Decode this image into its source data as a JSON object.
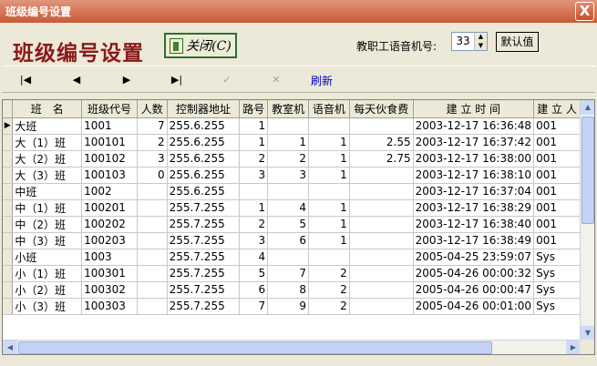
{
  "window": {
    "title": "班级编号设置",
    "close_glyph": "X"
  },
  "header": {
    "heading": "班级编号设置",
    "close_button_label": "关闭(C)"
  },
  "toolbar": {
    "first_icon": "first-record-icon",
    "first_glyph": "|◀",
    "prev_icon": "prev-record-icon",
    "prev_glyph": "◀",
    "next_icon": "next-record-icon",
    "next_glyph": "▶",
    "last_icon": "last-record-icon",
    "last_glyph": "▶|",
    "post_glyph": "✓",
    "cancel_glyph": "✕",
    "refresh_label": "刷新",
    "voice_label": "教职工语音机号:",
    "voice_value": "33",
    "default_label": "默认值"
  },
  "grid": {
    "headers": [
      "班　名",
      "班级代号",
      "人数",
      "控制器地址",
      "路号",
      "教室机",
      "语音机",
      "每天伙食费",
      "建 立 时 间",
      "建 立 人"
    ],
    "current_marker": "▶",
    "rows": [
      [
        "大班",
        "1001",
        "7",
        "255.6.255",
        "1",
        "",
        "",
        "",
        "2003-12-17 16:36:48",
        "001"
      ],
      [
        "大（1）班",
        "100101",
        "2",
        "255.6.255",
        "1",
        "1",
        "1",
        "2.55",
        "2003-12-17 16:37:42",
        "001"
      ],
      [
        "大（2）班",
        "100102",
        "3",
        "255.6.255",
        "2",
        "2",
        "1",
        "2.75",
        "2003-12-17 16:38:00",
        "001"
      ],
      [
        "大（3）班",
        "100103",
        "0",
        "255.6.255",
        "3",
        "3",
        "1",
        "",
        "2003-12-17 16:38:10",
        "001"
      ],
      [
        "中班",
        "1002",
        "",
        "255.6.255",
        "",
        "",
        "",
        "",
        "2003-12-17 16:37:04",
        "001"
      ],
      [
        "中（1）班",
        "100201",
        "",
        "255.7.255",
        "1",
        "4",
        "1",
        "",
        "2003-12-17 16:38:29",
        "001"
      ],
      [
        "中（2）班",
        "100202",
        "",
        "255.7.255",
        "2",
        "5",
        "1",
        "",
        "2003-12-17 16:38:40",
        "001"
      ],
      [
        "中（3）班",
        "100203",
        "",
        "255.7.255",
        "3",
        "6",
        "1",
        "",
        "2003-12-17 16:38:49",
        "001"
      ],
      [
        "小班",
        "1003",
        "",
        "255.7.255",
        "4",
        "",
        "",
        "",
        "2005-04-25 23:59:07",
        "Sys"
      ],
      [
        "小（1）班",
        "100301",
        "",
        "255.7.255",
        "5",
        "7",
        "2",
        "",
        "2005-04-26 00:00:32",
        "Sys"
      ],
      [
        "小（2）班",
        "100302",
        "",
        "255.7.255",
        "6",
        "8",
        "2",
        "",
        "2005-04-26 00:00:47",
        "Sys"
      ],
      [
        "小（3）班",
        "100303",
        "",
        "255.7.255",
        "7",
        "9",
        "2",
        "",
        "2005-04-26 00:01:00",
        "Sys"
      ]
    ],
    "numeric_columns": [
      2,
      4,
      5,
      6,
      7
    ]
  },
  "colors": {
    "title_bar": "#c85a36",
    "heading": "#8b1a1a",
    "refresh_link": "#0000c8"
  }
}
